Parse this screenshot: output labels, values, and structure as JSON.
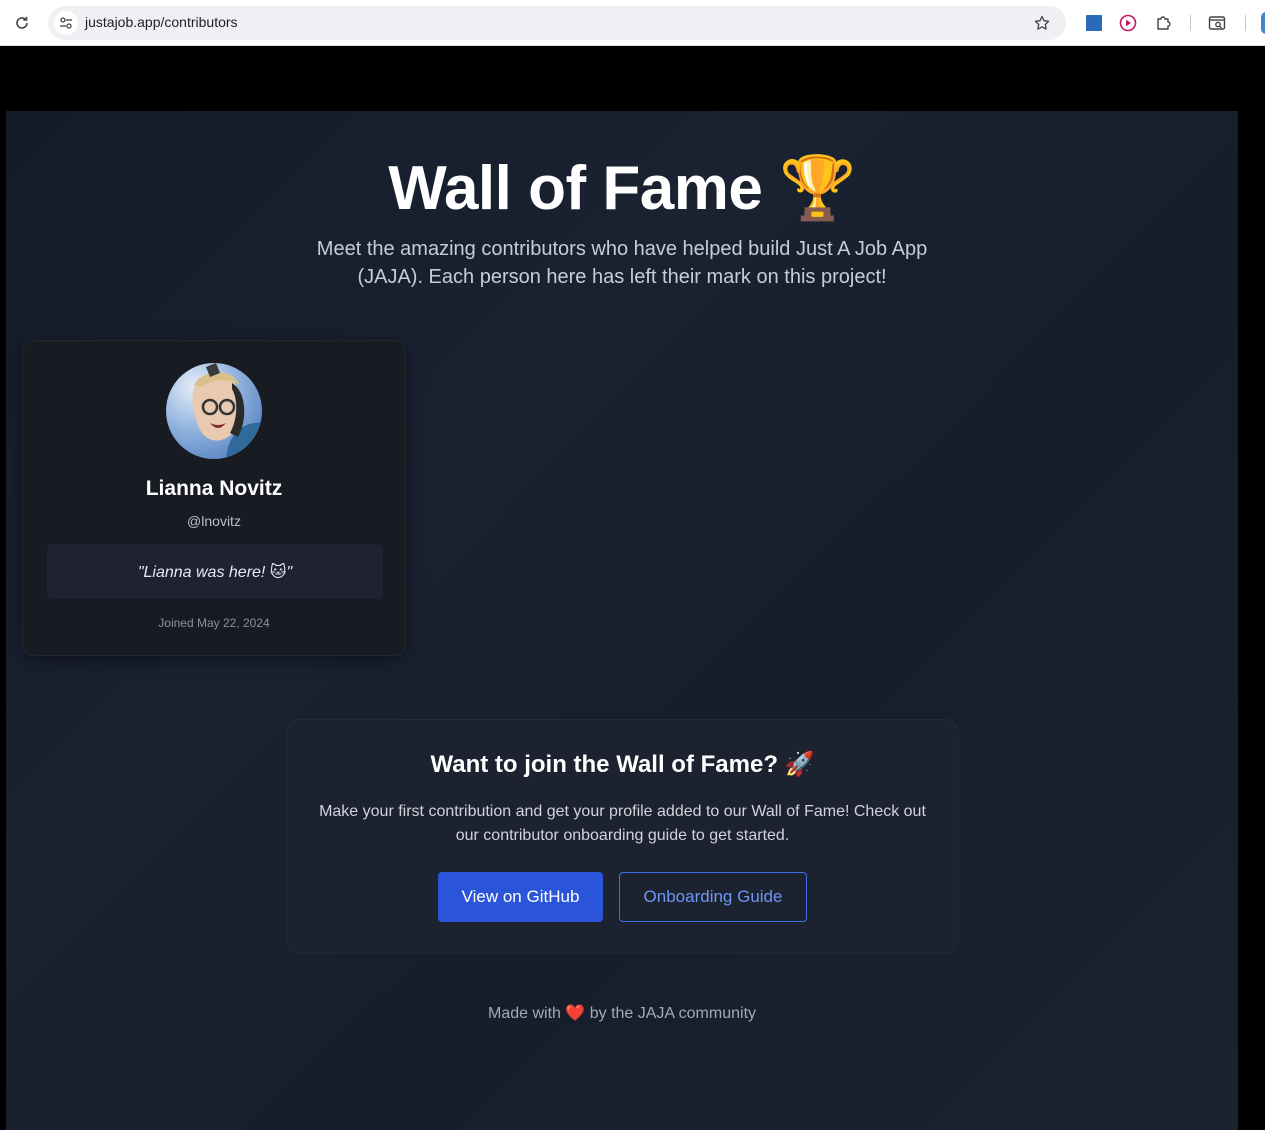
{
  "browser": {
    "url": "justajob.app/contributors"
  },
  "hero": {
    "title": "Wall of Fame 🏆",
    "subtitle": "Meet the amazing contributors who have helped build Just A Job App (JAJA). Each person here has left their mark on this project!"
  },
  "contributors": [
    {
      "name": "Lianna Novitz",
      "handle": "@lnovitz",
      "quote": "\"Lianna was here! 🐱\"",
      "joined": "Joined May 22, 2024"
    }
  ],
  "cta": {
    "title": "Want to join the Wall of Fame? 🚀",
    "text": "Make your first contribution and get your profile added to our Wall of Fame! Check out our contributor onboarding guide to get started.",
    "github_label": "View on GitHub",
    "guide_label": "Onboarding Guide"
  },
  "footer": {
    "text": "Made with ❤️ by the JAJA community"
  },
  "colors": {
    "primary_button": "#2b55d9",
    "outline_accent": "#6c97f2",
    "page_bg": "#1a2232"
  }
}
